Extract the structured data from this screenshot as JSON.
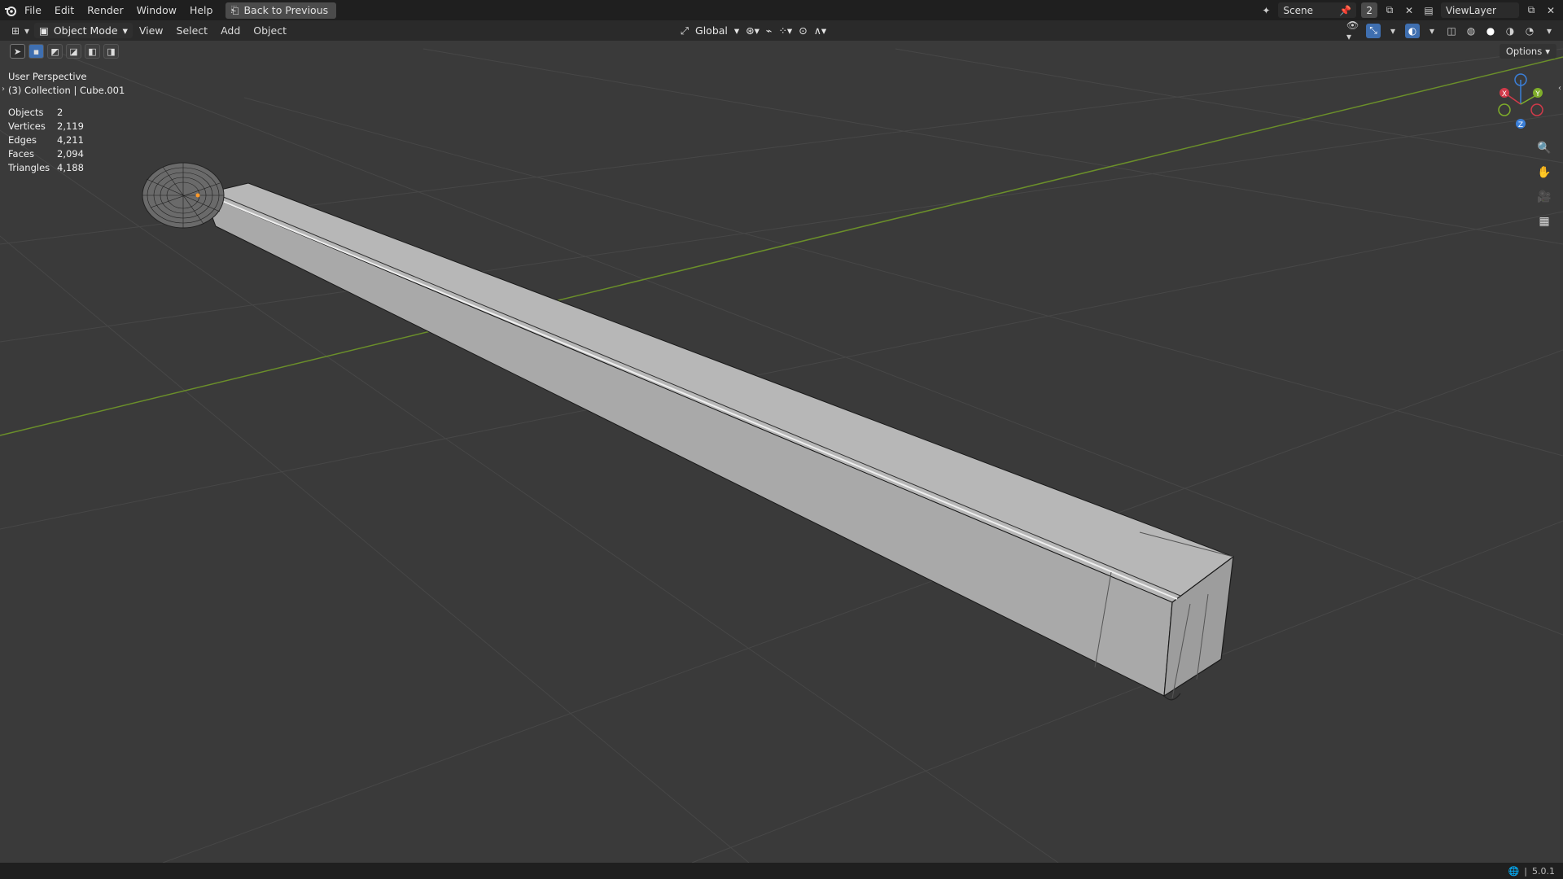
{
  "topbar": {
    "menus": [
      "File",
      "Edit",
      "Render",
      "Window",
      "Help"
    ],
    "back_label": "Back to Previous",
    "scene_name": "Scene",
    "scene_count": "2",
    "viewlayer_name": "ViewLayer"
  },
  "header": {
    "mode_label": "Object Mode",
    "menus": [
      "View",
      "Select",
      "Add",
      "Object"
    ],
    "transform_orientation": "Global",
    "options_label": "Options"
  },
  "viewport": {
    "perspective": "User Perspective",
    "collection_info": "(3) Collection | Cube.001",
    "stats": [
      {
        "label": "Objects",
        "value": "2"
      },
      {
        "label": "Vertices",
        "value": "2,119"
      },
      {
        "label": "Edges",
        "value": "4,211"
      },
      {
        "label": "Faces",
        "value": "2,094"
      },
      {
        "label": "Triangles",
        "value": "4,188"
      }
    ],
    "gizmo_axes": {
      "x": "X",
      "y": "Y",
      "z": "Z"
    }
  },
  "status": {
    "version": "5.0.1"
  },
  "colors": {
    "x_axis": "#d23a4a",
    "y_axis": "#7fae2a",
    "z_axis": "#3b7fd8",
    "accent": "#3f6fb0"
  }
}
